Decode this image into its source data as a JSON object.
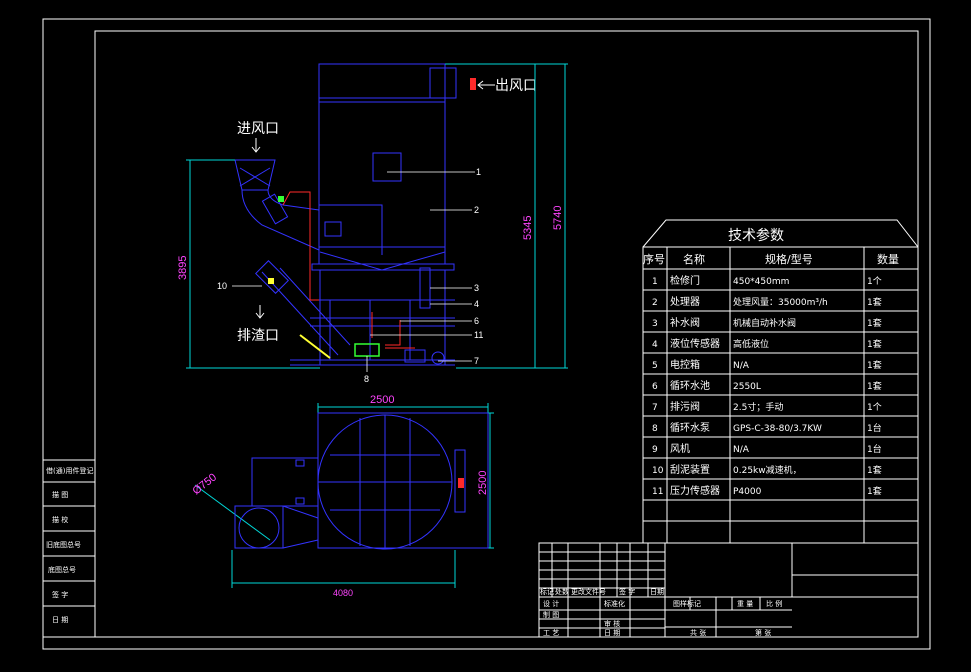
{
  "colors": {
    "background": "#000000",
    "frame": "#ffffff",
    "equipment": "#3333ff",
    "dimension": "#00d7d7",
    "callout": "#ffffff",
    "pipe": "#ff2a2a",
    "accent_yellow": "#ffff33",
    "accent_green": "#33ff33",
    "dim_text_magenta": "#ff44ff"
  },
  "labels": {
    "outlet": "出风口",
    "inlet": "进风口",
    "discharge": "排渣口"
  },
  "dimensions": {
    "height_5345": "5345",
    "height_5740": "5740",
    "height_3895": "3895",
    "width_top_2500": "2500",
    "width_side_2500": "2500",
    "width_4080": "4080",
    "dia_750": "Ø750"
  },
  "callouts": [
    "1",
    "2",
    "3",
    "4",
    "6",
    "11",
    "7",
    "8",
    "10"
  ],
  "tech_table": {
    "title": "技术参数",
    "headers": [
      "序号",
      "名称",
      "规格/型号",
      "数量"
    ],
    "rows": [
      [
        "1",
        "检修门",
        "450*450mm",
        "1个"
      ],
      [
        "2",
        "处理器",
        "处理风量：35000m³/h",
        "1套"
      ],
      [
        "3",
        "补水阀",
        "机械自动补水阀",
        "1套"
      ],
      [
        "4",
        "液位传感器",
        "高低液位",
        "1套"
      ],
      [
        "5",
        "电控箱",
        "N/A",
        "1套"
      ],
      [
        "6",
        "循环水池",
        "2550L",
        "1套"
      ],
      [
        "7",
        "排污阀",
        "2.5寸；手动",
        "1个"
      ],
      [
        "8",
        "循环水泵",
        "GPS-C-38-80/3.7KW",
        "1台"
      ],
      [
        "9",
        "风机",
        "N/A",
        "1台"
      ],
      [
        "10",
        "刮泥装置",
        "0.25kw减速机，",
        "1套"
      ],
      [
        "11",
        "压力传感器",
        "P4000",
        "1套"
      ]
    ]
  },
  "left_strip": [
    "借(通)用件登记",
    "描 图",
    "描 校",
    "旧底图总号",
    "底图总号",
    "签 字",
    "日 期"
  ],
  "title_block": {
    "row_a": [
      "标记",
      "处数",
      "更改文件号",
      "签 字",
      "日期"
    ],
    "row_b": [
      "设 计",
      "标准化",
      "图样标记",
      "重 量",
      "比 例"
    ],
    "row_c": [
      "制 图",
      "审 核"
    ],
    "row_d": [
      "工 艺",
      "日 期",
      "共 张",
      "第 张"
    ]
  }
}
